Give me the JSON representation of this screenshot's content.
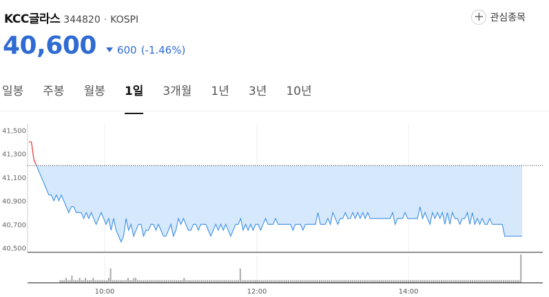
{
  "header": {
    "name": "KCC글라스",
    "code": "344820",
    "separator": "·",
    "market": "KOSPI",
    "watch_label": "관심종목"
  },
  "quote": {
    "price": "40,600",
    "change": "600",
    "change_pct": "(-1.46%)",
    "down_color": "#2f6bd2"
  },
  "tabs": [
    {
      "label": "일봉",
      "active": false
    },
    {
      "label": "주봉",
      "active": false
    },
    {
      "label": "월봉",
      "active": false
    },
    {
      "label": "1일",
      "active": true
    },
    {
      "label": "3개월",
      "active": false
    },
    {
      "label": "1년",
      "active": false
    },
    {
      "label": "3년",
      "active": false
    },
    {
      "label": "10년",
      "active": false
    }
  ],
  "chart_data": {
    "type": "line",
    "y_ticks": [
      "41,500",
      "41,300",
      "41,100",
      "40,900",
      "40,700",
      "40,500"
    ],
    "x_ticks": [
      "10:00",
      "12:00",
      "14:00"
    ],
    "ylim": [
      40480,
      41520
    ],
    "prev_close": 41200,
    "up_color": "#e63b3b",
    "line_color": "#3a8ee6",
    "fill_color": "#d6e8fb",
    "volume_color": "#a9a9a9",
    "series": [
      {
        "values": [
          41400,
          41400,
          41250,
          41200,
          41150,
          41100,
          41050,
          41000,
          40950,
          40950,
          40900,
          40950,
          40900,
          40950,
          40900,
          40850,
          40800,
          40850,
          40850,
          40800,
          40800,
          40800,
          40750,
          40800,
          40750,
          40800,
          40750,
          40700,
          40750,
          40800,
          40750,
          40700,
          40750,
          40650,
          40750,
          40650,
          40600,
          40550,
          40600,
          40750,
          40650,
          40700,
          40600,
          40650,
          40700,
          40700,
          40600,
          40650,
          40650,
          40700,
          40700,
          40650,
          40700,
          40650,
          40600,
          40600,
          40650,
          40700,
          40600,
          40650,
          40750,
          40700,
          40750,
          40700,
          40650,
          40650,
          40700,
          40700,
          40650,
          40700,
          40700,
          40700,
          40650,
          40600,
          40650,
          40700,
          40650,
          40700,
          40650,
          40700,
          40650,
          40600,
          40650,
          40700,
          40700,
          40750,
          40650,
          40700,
          40650,
          40700,
          40650,
          40700,
          40700,
          40650,
          40700,
          40750,
          40700,
          40700,
          40700,
          40750,
          40700,
          40700,
          40700,
          40700,
          40700,
          40700,
          40650,
          40700,
          40700,
          40700,
          40650,
          40700,
          40700,
          40700,
          40700,
          40700,
          40800,
          40700,
          40700,
          40700,
          40750,
          40700,
          40800,
          40750,
          40700,
          40750,
          40750,
          40800,
          40750,
          40750,
          40800,
          40750,
          40800,
          40750,
          40800,
          40750,
          40800,
          40750,
          40750,
          40750,
          40750,
          40750,
          40750,
          40750,
          40750,
          40750,
          40800,
          40700,
          40750,
          40750,
          40750,
          40800,
          40750,
          40750,
          40750,
          40750,
          40750,
          40850,
          40750,
          40800,
          40750,
          40700,
          40800,
          40750,
          40800,
          40750,
          40800,
          40700,
          40800,
          40700,
          40800,
          40750,
          40750,
          40700,
          40750,
          40750,
          40800,
          40700,
          40800,
          40700,
          40750,
          40700,
          40750,
          40700,
          40700,
          40750,
          40700,
          40700,
          40700,
          40700,
          40700,
          40600,
          40600,
          40600,
          40600,
          40600,
          40600,
          40600,
          40600
        ]
      }
    ],
    "volume": [
      0,
      0,
      0,
      0,
      0,
      0,
      0,
      0,
      0,
      0,
      0,
      0,
      0,
      1,
      1,
      1,
      2,
      1,
      1,
      3,
      1,
      1,
      1,
      2,
      1,
      1,
      2,
      1,
      1,
      1,
      2,
      1,
      1,
      1,
      1,
      1,
      1,
      1,
      2,
      6,
      1,
      1,
      1,
      1,
      1,
      1,
      1,
      1,
      2,
      1,
      1,
      2,
      2,
      1,
      1,
      1,
      1,
      1,
      1,
      1,
      1,
      1,
      1,
      1,
      1,
      1,
      1,
      1,
      1,
      1,
      1,
      1,
      1,
      1,
      1,
      1,
      1,
      2,
      1,
      1,
      1,
      1,
      1,
      1,
      1,
      1,
      1,
      1,
      1,
      1,
      1,
      1,
      1,
      1,
      1,
      1,
      1,
      1,
      1,
      1,
      1,
      1,
      1,
      1,
      1,
      1,
      6,
      1,
      1,
      1,
      1,
      1,
      1,
      1,
      1,
      1,
      1,
      1,
      1,
      1,
      1,
      1,
      1,
      1,
      1,
      1,
      1,
      1,
      1,
      1,
      1,
      1,
      1,
      1,
      1,
      1,
      1,
      1,
      1,
      1,
      1,
      1,
      1,
      1,
      1,
      1,
      1,
      1,
      1,
      1,
      1,
      1,
      1,
      1,
      1,
      1,
      1,
      1,
      1,
      1,
      1,
      1,
      1,
      1,
      1,
      1,
      1,
      1,
      1,
      1,
      1,
      1,
      1,
      1,
      1,
      1,
      1,
      1,
      1,
      1,
      1,
      1,
      1,
      1,
      1,
      1,
      1,
      1,
      1,
      1,
      1,
      1,
      1,
      1,
      1,
      1,
      1,
      1,
      1,
      1,
      1,
      1,
      1,
      1,
      1,
      1,
      1,
      1,
      1,
      1,
      1,
      1,
      1,
      1,
      1,
      1,
      1,
      1,
      1,
      1,
      1,
      1,
      1,
      1,
      1,
      1,
      1,
      1,
      1,
      1,
      1,
      1,
      1,
      1,
      1,
      1,
      1,
      1,
      1,
      1,
      1,
      1,
      1,
      1,
      1,
      1,
      1,
      1,
      1,
      1,
      1,
      12
    ]
  }
}
